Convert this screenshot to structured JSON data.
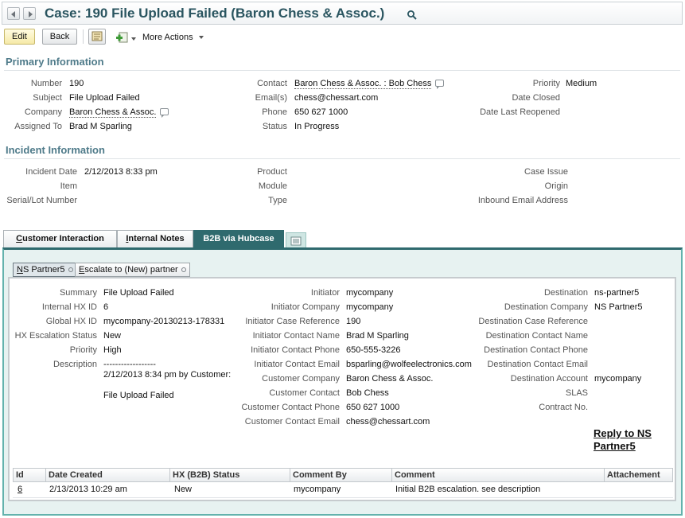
{
  "header": {
    "title": "Case: 190 File Upload Failed (Baron Chess & Assoc.)"
  },
  "toolbar": {
    "edit_label": "Edit",
    "back_label": "Back",
    "more_actions_label": "More Actions"
  },
  "primary": {
    "heading": "Primary Information",
    "number_label": "Number",
    "number_value": "190",
    "subject_label": "Subject",
    "subject_value": "File Upload Failed",
    "company_label": "Company",
    "company_value": "Baron Chess & Assoc.",
    "assigned_label": "Assigned To",
    "assigned_value": "Brad M Sparling",
    "contact_label": "Contact",
    "contact_value": "Baron Chess & Assoc. : Bob Chess",
    "email_label": "Email(s)",
    "email_value": "chess@chessart.com",
    "phone_label": "Phone",
    "phone_value": "650 627 1000",
    "status_label": "Status",
    "status_value": "In Progress",
    "priority_label": "Priority",
    "priority_value": "Medium",
    "date_closed_label": "Date Closed",
    "date_reopened_label": "Date Last Reopened"
  },
  "incident": {
    "heading": "Incident Information",
    "date_label": "Incident Date",
    "date_value": "2/12/2013 8:33 pm",
    "item_label": "Item",
    "serial_label": "Serial/Lot Number",
    "product_label": "Product",
    "module_label": "Module",
    "type_label": "Type",
    "case_issue_label": "Case Issue",
    "origin_label": "Origin",
    "inbound_label": "Inbound Email Address"
  },
  "tabs": {
    "customer_interaction_first": "C",
    "customer_interaction_rest": "ustomer Interaction",
    "internal_notes_first": "I",
    "internal_notes_rest": "nternal Notes",
    "b2b_label": "B2B via Hubcase"
  },
  "subtabs": {
    "ns_partner_first": "N",
    "ns_partner_rest": "S Partner5",
    "escalate_first": "E",
    "escalate_rest": "scalate to (New) partner"
  },
  "b2b": {
    "summary_label": "Summary",
    "summary_value": "File Upload Failed",
    "internal_id_label": "Internal HX ID",
    "internal_id_value": "6",
    "global_id_label": "Global HX ID",
    "global_id_value": "mycompany-20130213-178331",
    "escalation_label": "HX Escalation Status",
    "escalation_value": "New",
    "priority_label": "Priority",
    "priority_value": "High",
    "description_label": "Description",
    "description_line1": "------------------",
    "description_line2": "2/12/2013 8:34 pm by Customer:",
    "description_line3": "File Upload Failed",
    "initiator_label": "Initiator",
    "initiator_value": "mycompany",
    "initiator_company_label": "Initiator Company",
    "initiator_company_value": "mycompany",
    "initiator_case_ref_label": "Initiator Case Reference",
    "initiator_case_ref_value": "190",
    "initiator_contact_name_label": "Initiator Contact Name",
    "initiator_contact_name_value": "Brad M Sparling",
    "initiator_contact_phone_label": "Initiator Contact Phone",
    "initiator_contact_phone_value": "650-555-3226",
    "initiator_contact_email_label": "Initiator Contact Email",
    "initiator_contact_email_value": "bsparling@wolfeelectronics.com",
    "customer_company_label": "Customer Company",
    "customer_company_value": "Baron Chess & Assoc.",
    "customer_contact_label": "Customer Contact",
    "customer_contact_value": "Bob Chess",
    "customer_contact_phone_label": "Customer Contact Phone",
    "customer_contact_phone_value": "650 627 1000",
    "customer_contact_email_label": "Customer Contact Email",
    "customer_contact_email_value": "chess@chessart.com",
    "destination_label": "Destination",
    "destination_value": "ns-partner5",
    "destination_company_label": "Destination Company",
    "destination_company_value": "NS Partner5",
    "destination_case_ref_label": "Destination Case Reference",
    "destination_contact_name_label": "Destination Contact Name",
    "destination_contact_phone_label": "Destination Contact Phone",
    "destination_contact_email_label": "Destination Contact Email",
    "destination_account_label": "Destination Account",
    "destination_account_value": "mycompany",
    "slas_label": "SLAS",
    "contract_label": "Contract No.",
    "reply_label": "Reply to NS Partner5"
  },
  "table": {
    "headers": [
      "Id",
      "Date Created",
      "HX (B2B) Status",
      "Comment By",
      "Comment",
      "Attachement"
    ],
    "rows": [
      [
        "6",
        "2/13/2013 10:29 am",
        "New",
        "mycompany",
        "Initial B2B escalation. see description",
        ""
      ]
    ]
  },
  "colors": {
    "title": "#2a5560",
    "section_heading": "#4f7b8a",
    "active_tab": "#2f6a6e",
    "panel_border": "#63b2ad"
  }
}
